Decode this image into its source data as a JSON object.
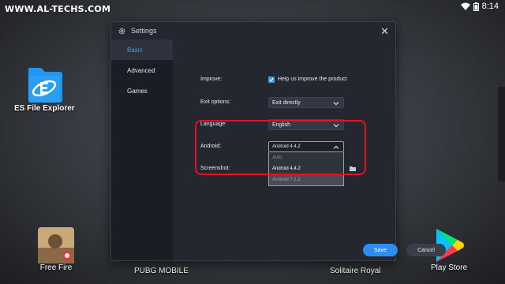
{
  "watermark": "WWW.AL-TECHS.COM",
  "status": {
    "time": "8:14"
  },
  "desktop": {
    "es_label": "ES File Explorer",
    "freefire_label": "Free Fire",
    "pubg_label": "PUBG MOBILE",
    "solitaire_label": "Solitaire Royal",
    "playstore_label": "Play Store"
  },
  "dialog": {
    "title": "Settings",
    "sidebar": [
      {
        "label": "Basic"
      },
      {
        "label": "Advanced"
      },
      {
        "label": "Games"
      }
    ],
    "improve": {
      "label": "Improve:",
      "checkbox_label": "Help us improve the product",
      "checked": true
    },
    "exit_options": {
      "label": "Exit options:",
      "value": "Exit directly"
    },
    "language": {
      "label": "Language:",
      "value": "English"
    },
    "android": {
      "label": "Android:",
      "value": "Android 4.4.2",
      "options": [
        "Auto",
        "Android 4.4.2",
        "Android 7.1.2"
      ]
    },
    "screenshot": {
      "label": "Screenshot:"
    },
    "save_label": "Save",
    "cancel_label": "Cancel"
  },
  "colors": {
    "accent": "#3c9cf0",
    "annotation": "#e0141e",
    "dialog_bg": "#242730",
    "sidebar_bg": "#1b1d24"
  }
}
